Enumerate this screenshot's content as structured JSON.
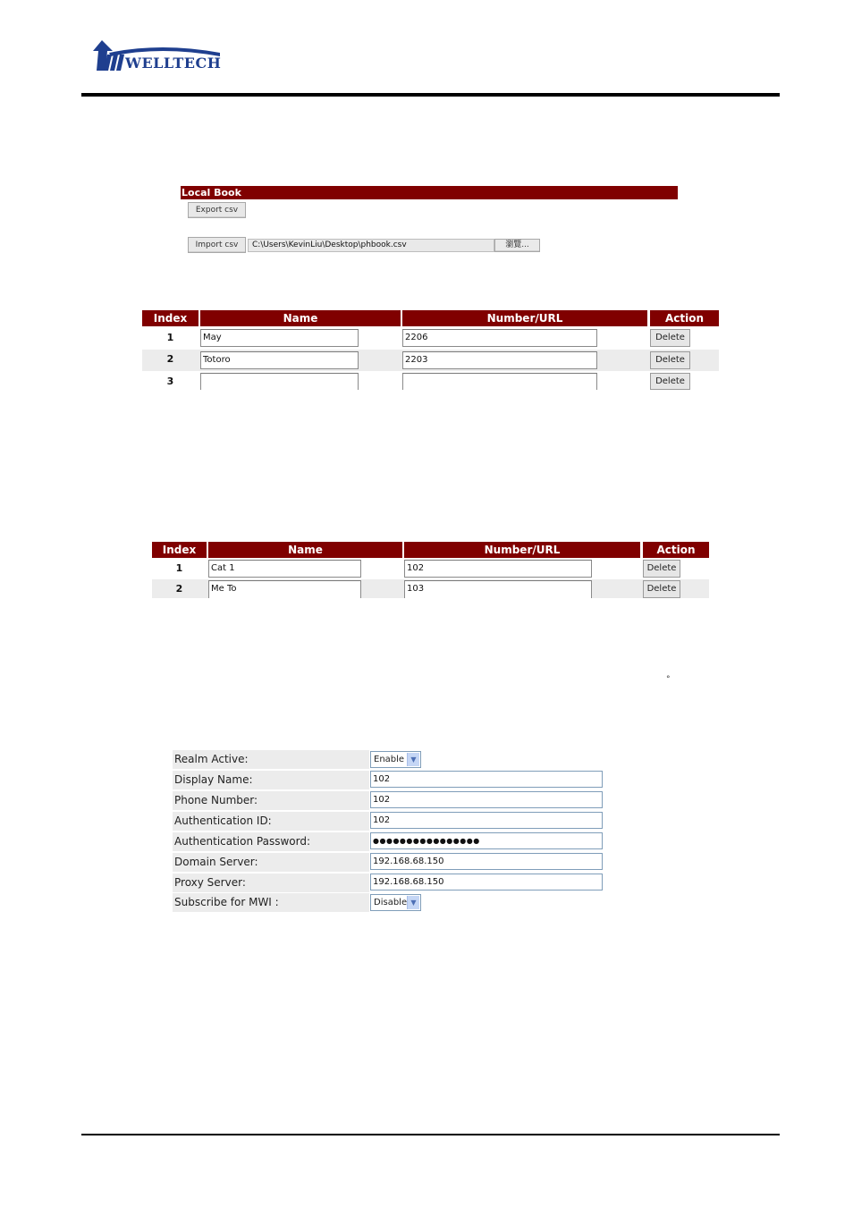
{
  "header": {
    "logo_text": "WELLTECH",
    "logo_icon": "welltech-arrow-logo"
  },
  "local_book": {
    "title": "Local Book",
    "export_label": "Export csv",
    "import_label": "Import csv",
    "file_path_value": "C:\\Users\\KevinLiu\\Desktop\\phbook.csv",
    "browse_label": "瀏覽..."
  },
  "phonebook_table_1": {
    "headers": [
      "Index",
      "Name",
      "Number/URL",
      "Action"
    ],
    "rows": [
      {
        "index": "1",
        "name": "May",
        "number": "2206",
        "action": "Delete"
      },
      {
        "index": "2",
        "name": "Totoro",
        "number": "2203",
        "action": "Delete"
      },
      {
        "index": "3",
        "name": "",
        "number": "",
        "action": "Delete"
      }
    ]
  },
  "phonebook_table_2": {
    "headers": [
      "Index",
      "Name",
      "Number/URL",
      "Action"
    ],
    "rows": [
      {
        "index": "1",
        "name": "Cat 1",
        "number": "102",
        "action": "Delete"
      },
      {
        "index": "2",
        "name": "Me To",
        "number": "103",
        "action": "Delete"
      }
    ]
  },
  "stray_mark": "°",
  "realm_form": {
    "fields": [
      {
        "label": "Realm Active:",
        "type": "select",
        "value": "Enable"
      },
      {
        "label": "Display Name:",
        "type": "text",
        "value": "102"
      },
      {
        "label": "Phone Number:",
        "type": "text",
        "value": "102"
      },
      {
        "label": "Authentication ID:",
        "type": "text",
        "value": "102"
      },
      {
        "label": "Authentication Password:",
        "type": "password",
        "value": "●●●●●●●●●●●●●●●●"
      },
      {
        "label": "Domain Server:",
        "type": "text",
        "value": "192.168.68.150"
      },
      {
        "label": "Proxy Server:",
        "type": "text",
        "value": "192.168.68.150"
      },
      {
        "label": "Subscribe for MWI :",
        "type": "select",
        "value": "Disable"
      }
    ]
  },
  "colors": {
    "header_bar": "#800000",
    "alt_row": "#ececec",
    "logo_blue": "#1f3f8f"
  }
}
